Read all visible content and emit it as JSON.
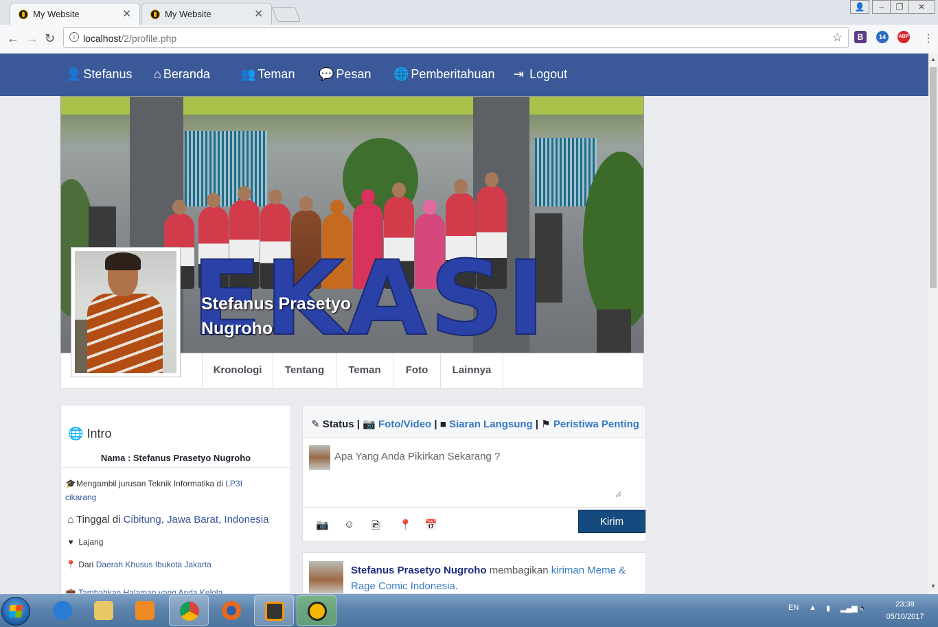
{
  "browser": {
    "tabs": [
      {
        "title": "My Website",
        "active": true
      },
      {
        "title": "My Website",
        "active": false
      }
    ],
    "url_host": "localhost",
    "url_path": "/2/profile.php",
    "extensions": [
      {
        "name": "bootstrap-extension-icon",
        "label": "B",
        "color": "#5b3c86"
      },
      {
        "name": "gear-extension-icon",
        "label": "14",
        "color": "#2f6bc4"
      },
      {
        "name": "adblock-plus-icon",
        "label": "ABP",
        "color": "#d6262b"
      }
    ]
  },
  "navbar": {
    "items": [
      {
        "label": "Stefanus",
        "icon": "user-icon"
      },
      {
        "label": "Beranda",
        "icon": "home-icon"
      },
      {
        "label": "Teman",
        "icon": "friends-icon"
      },
      {
        "label": "Pesan",
        "icon": "message-icon"
      },
      {
        "label": "Pemberitahuan",
        "icon": "globe-icon"
      },
      {
        "label": "Logout",
        "icon": "logout-icon"
      }
    ]
  },
  "profile": {
    "name_line1": "Stefanus Prasetyo",
    "name_line2": "Nugroho",
    "cover_sign": "EKASI",
    "tabs": [
      "Kronologi",
      "Tentang",
      "Teman",
      "Foto",
      "Lainnya"
    ]
  },
  "intro": {
    "title": "Intro",
    "name_row": "Nama : Stefanus Prasetyo Nugroho",
    "education_text": "Mengambil jurusan Teknik Informatika di ",
    "education_link": "LP3I cikarang",
    "lives_text": "Tinggal di ",
    "lives_link": "Cibitung, Jawa Barat, Indonesia",
    "relationship": "Lajang",
    "from_text": "Dari ",
    "from_link": "Daerah Khusus Ibukota Jakarta",
    "more_link": "Tambahkan Halaman yang Anda Kelola"
  },
  "composer": {
    "status": "Status",
    "photo_video": "Foto/Video",
    "live": "Siaran Langsung",
    "life_event": "Peristiwa Penting",
    "placeholder": "Apa Yang Anda Pikirkan Sekarang ?",
    "submit": "Kirim",
    "tools": [
      "camera-icon",
      "smiley-icon",
      "image-file-icon",
      "location-pin-icon",
      "calendar-icon"
    ]
  },
  "post": {
    "author": "Stefanus Prasetyo Nugroho",
    "action": " membagikan ",
    "link": "kiriman Meme & Rage Comic Indonesia",
    "suffix": "."
  },
  "taskbar": {
    "language": "EN",
    "time": "23:38",
    "date": "05/10/2017",
    "apps": [
      {
        "name": "internet-explorer-icon",
        "color": "#2a7bd4"
      },
      {
        "name": "file-explorer-icon",
        "color": "#e8c766"
      },
      {
        "name": "media-player-icon",
        "color": "#f08a24"
      },
      {
        "name": "chrome-icon",
        "color": "#db4437"
      },
      {
        "name": "firefox-icon",
        "color": "#e86a1c"
      },
      {
        "name": "sublime-text-icon",
        "color": "#ff9800"
      },
      {
        "name": "xampp-icon",
        "color": "#f2b600"
      }
    ]
  }
}
